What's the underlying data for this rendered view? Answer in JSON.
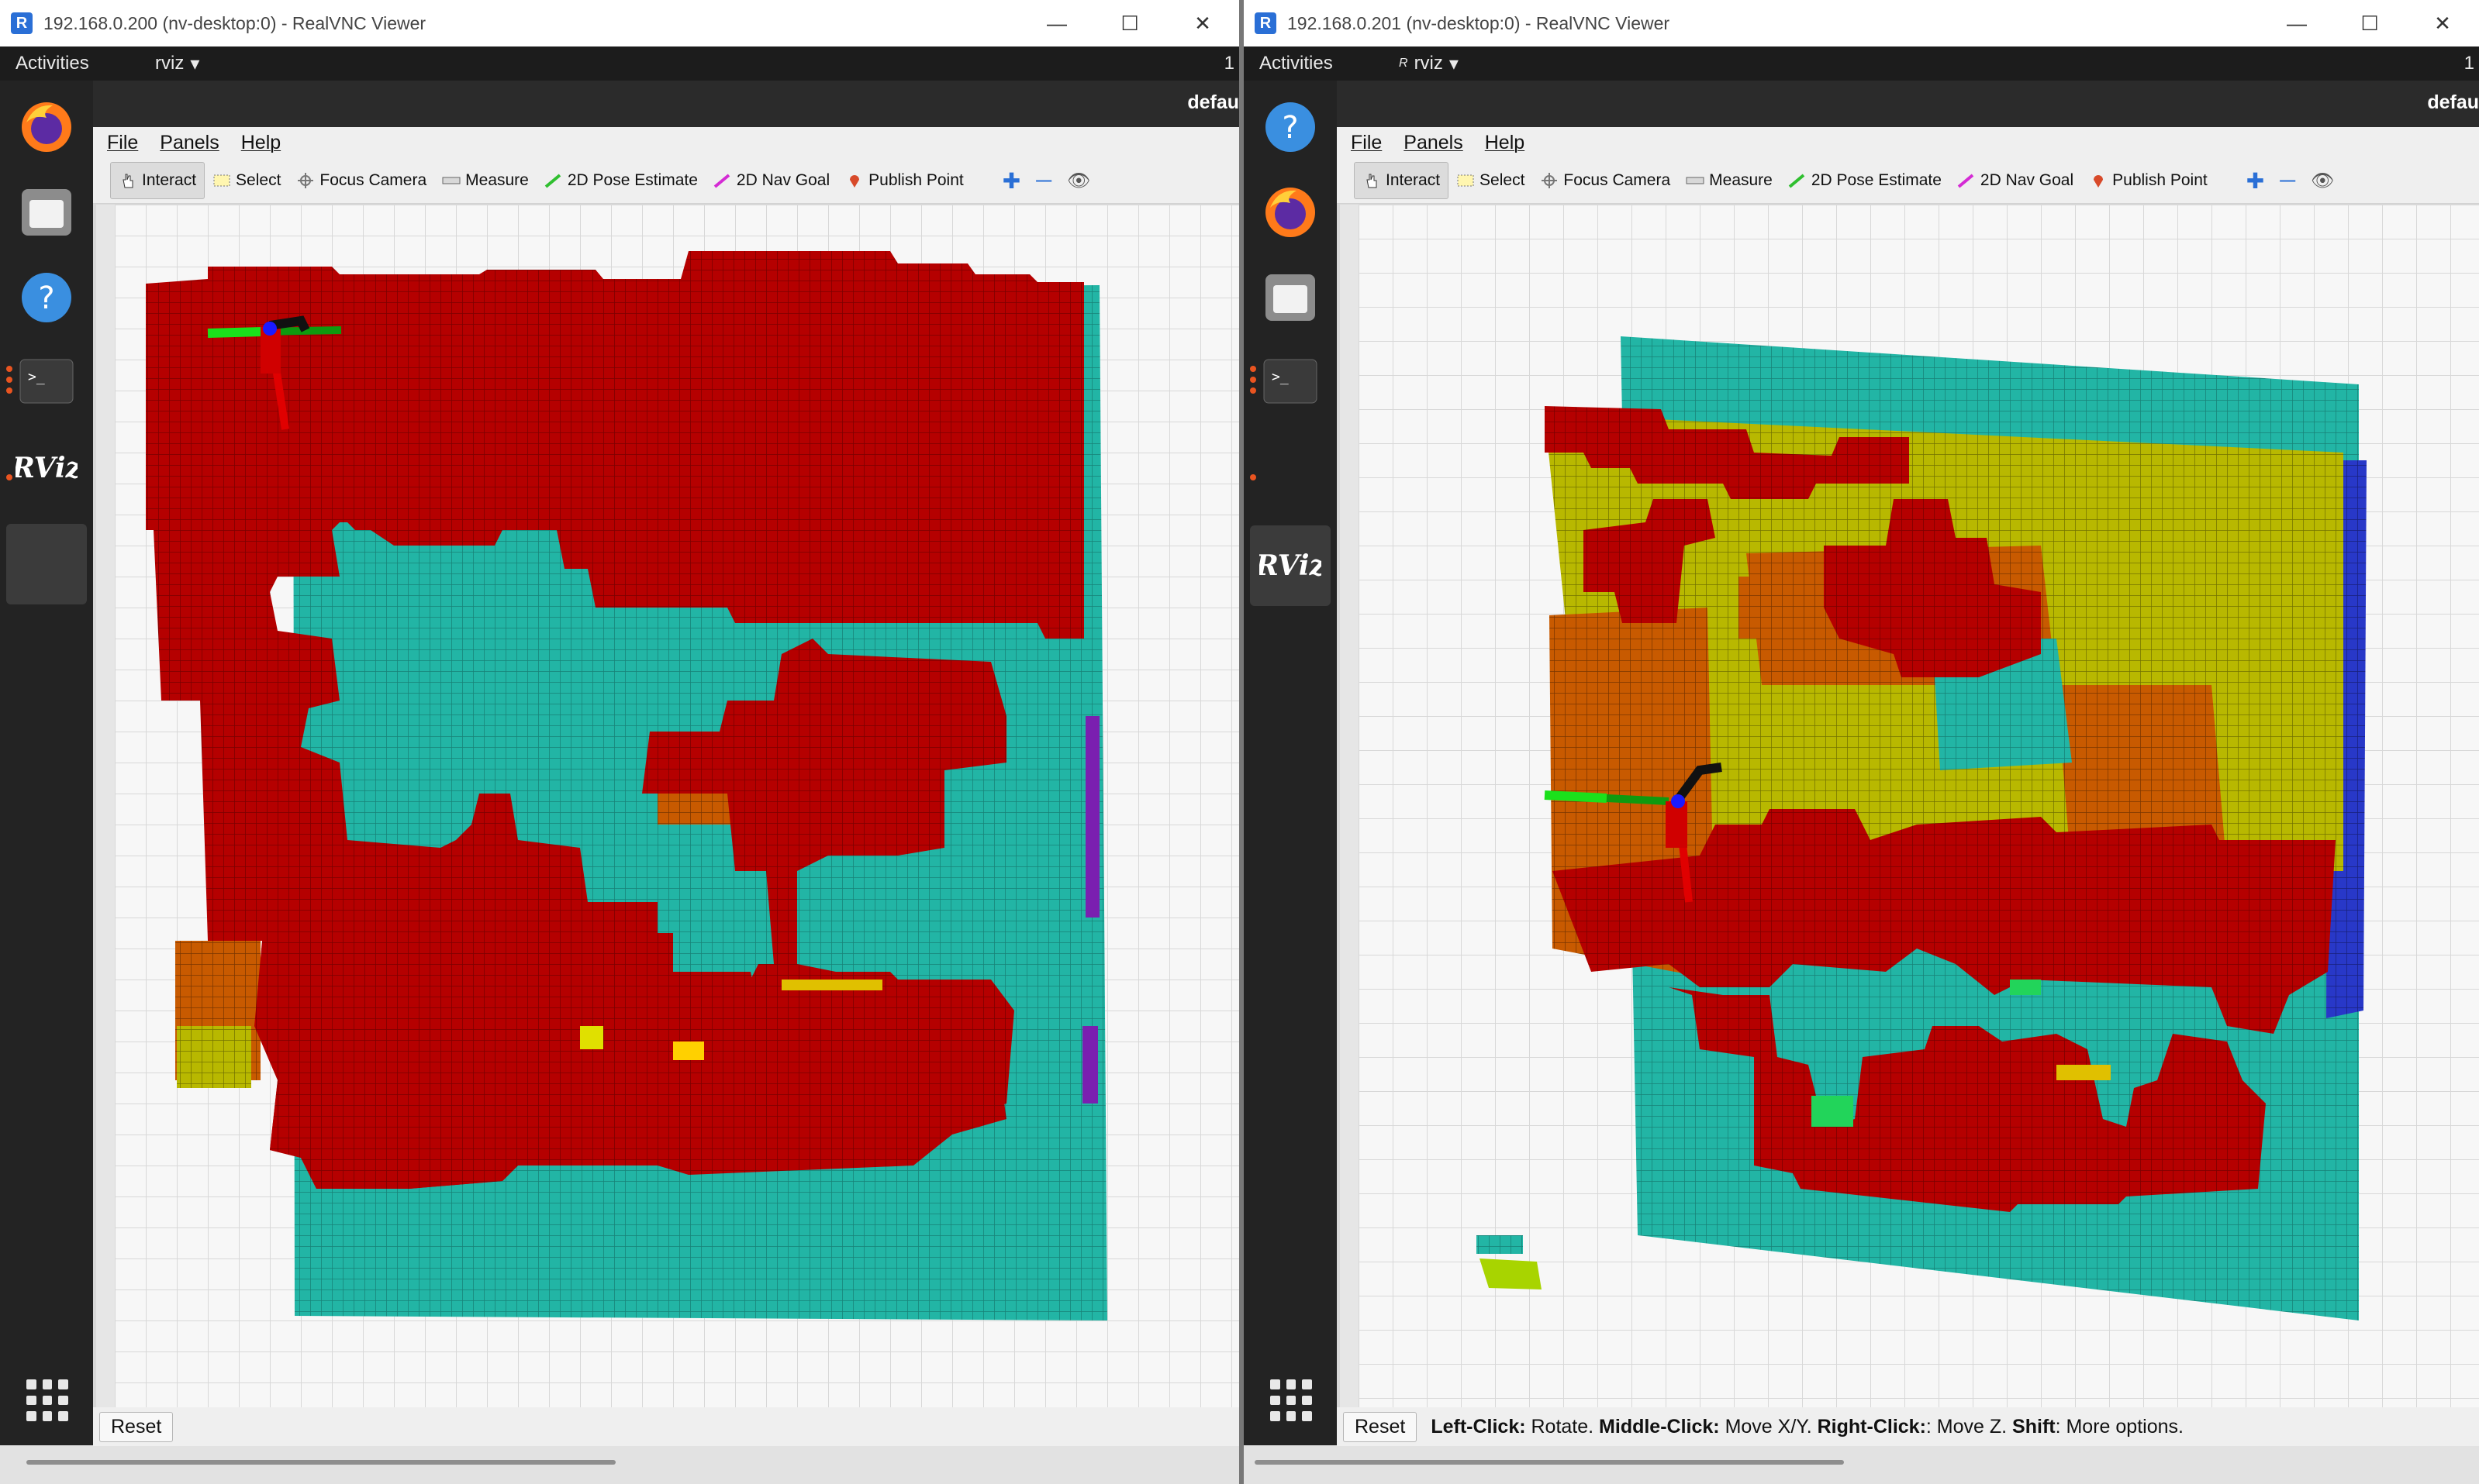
{
  "windows": [
    {
      "title": "192.168.0.200 (nv-desktop:0) - RealVNC Viewer",
      "topbar": {
        "activities": "Activities",
        "app": "rviz",
        "num": "1"
      },
      "header_title": "defau",
      "menu": [
        "File",
        "Panels",
        "Help"
      ],
      "tools": [
        "Interact",
        "Select",
        "Focus Camera",
        "Measure",
        "2D Pose Estimate",
        "2D Nav Goal",
        "Publish Point"
      ],
      "reset": "Reset",
      "hint": ""
    },
    {
      "title": "192.168.0.201 (nv-desktop:0) - RealVNC Viewer",
      "topbar": {
        "activities": "Activities",
        "app": "rviz",
        "num": "1"
      },
      "header_title": "defau",
      "menu": [
        "File",
        "Panels",
        "Help"
      ],
      "tools": [
        "Interact",
        "Select",
        "Focus Camera",
        "Measure",
        "2D Pose Estimate",
        "2D Nav Goal",
        "Publish Point"
      ],
      "reset": "Reset",
      "hint": {
        "k1": "Left-Click:",
        "v1": " Rotate. ",
        "k2": "Middle-Click:",
        "v2": " Move X/Y. ",
        "k3": "Right-Click:",
        "v3": ": Move Z. ",
        "k4": "Shift",
        "v4": ": More options."
      }
    }
  ],
  "colors": {
    "occupied_high": "#b50000",
    "occupied_mid": "#c85a00",
    "occupied_low": "#b8b800",
    "floor": "#22b5a5",
    "accent_purple": "#7a1fb0",
    "grid": "#d4d4d4",
    "dock": "#232323"
  },
  "icons": {
    "window": "rviz-window-icon",
    "minimize": "minimize-icon",
    "maximize": "maximize-icon",
    "close": "close-icon"
  }
}
